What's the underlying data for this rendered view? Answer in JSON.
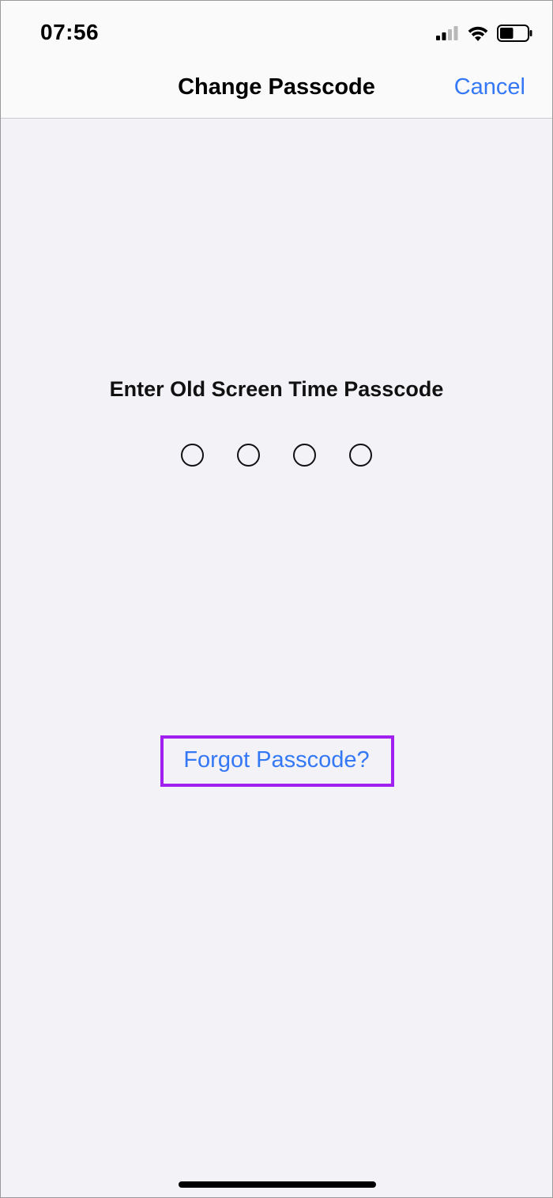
{
  "status_bar": {
    "time": "07:56",
    "icons": [
      "cellular-signal-icon",
      "wifi-icon",
      "battery-icon"
    ],
    "battery_level": 0.5
  },
  "nav": {
    "title": "Change Passcode",
    "cancel_label": "Cancel"
  },
  "passcode": {
    "prompt": "Enter Old Screen Time Passcode",
    "digit_count": 4,
    "entered": 0
  },
  "forgot": {
    "label": "Forgot Passcode?",
    "highlight_color": "#a020f0"
  },
  "colors": {
    "accent": "#3478f6",
    "background": "#f2f2f7",
    "bar_background": "#fafafa"
  }
}
